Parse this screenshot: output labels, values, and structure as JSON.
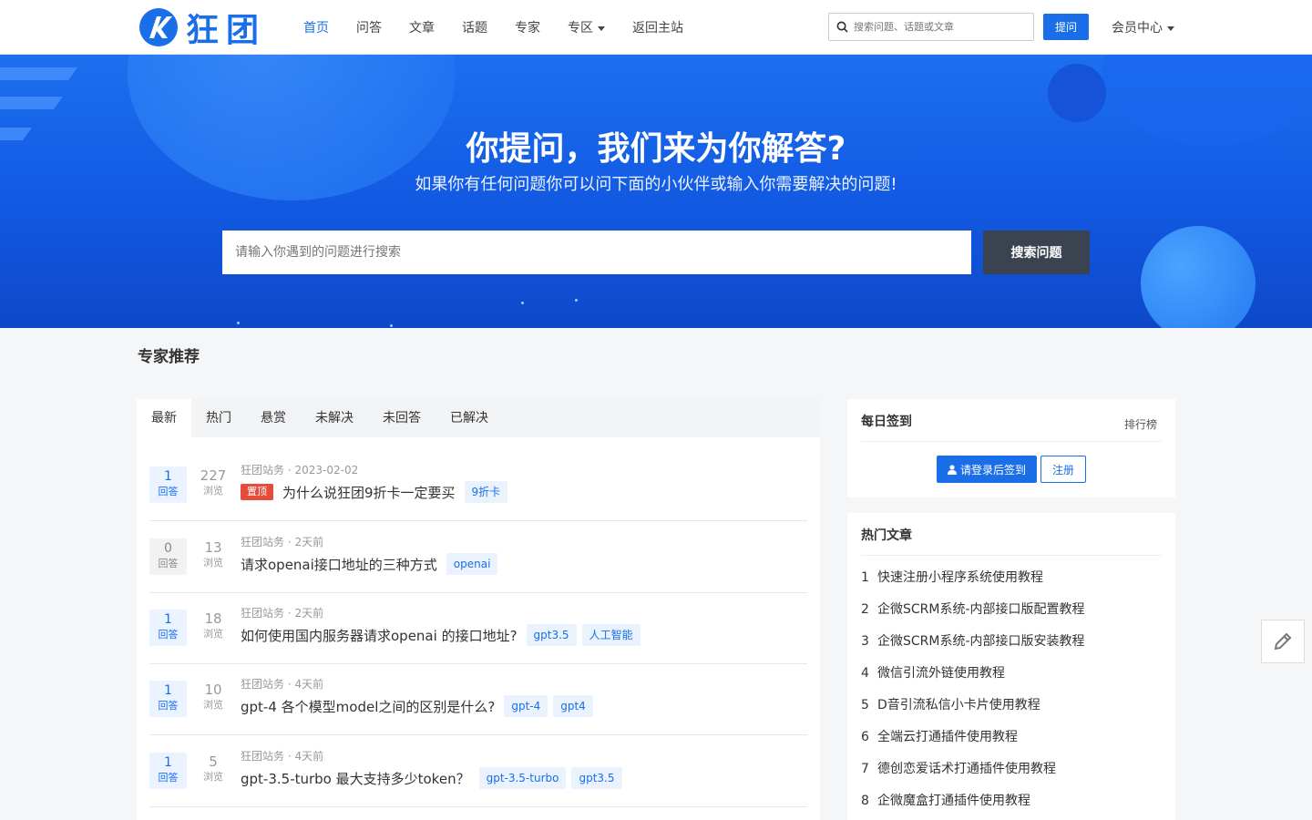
{
  "brand": {
    "name": "狂团",
    "accent": "#1a6fe8"
  },
  "nav": {
    "items": [
      {
        "label": "首页",
        "active": true
      },
      {
        "label": "问答"
      },
      {
        "label": "文章"
      },
      {
        "label": "话题"
      },
      {
        "label": "专家"
      },
      {
        "label": "专区",
        "dropdown": true
      },
      {
        "label": "返回主站"
      }
    ],
    "search_placeholder": "搜索问题、话题或文章",
    "ask_label": "提问",
    "member_label": "会员中心"
  },
  "banner": {
    "title": "你提问，我们来为你解答?",
    "subtitle": "如果你有任何问题你可以问下面的小伙伴或输入你需要解决的问题!",
    "search_placeholder": "请输入你遇到的问题进行搜索",
    "search_button": "搜索问题"
  },
  "experts": {
    "title": "专家推荐"
  },
  "tabs": [
    "最新",
    "热门",
    "悬赏",
    "未解决",
    "未回答",
    "已解决"
  ],
  "questions": [
    {
      "answers": "1",
      "answers_label": "回答",
      "views": "227",
      "views_label": "浏览",
      "author": "狂团站务",
      "time": "2023-02-02",
      "pinned": "置顶",
      "title": "为什么说狂团9折卡一定要买",
      "tags": [
        "9折卡"
      ]
    },
    {
      "answers": "0",
      "answers_label": "回答",
      "views": "13",
      "views_label": "浏览",
      "author": "狂团站务",
      "time": "2天前",
      "title": "请求openai接口地址的三种方式",
      "tags": [
        "openai"
      ]
    },
    {
      "answers": "1",
      "answers_label": "回答",
      "views": "18",
      "views_label": "浏览",
      "author": "狂团站务",
      "time": "2天前",
      "title": "如何使用国内服务器请求openai 的接口地址?",
      "tags": [
        "gpt3.5",
        "人工智能"
      ]
    },
    {
      "answers": "1",
      "answers_label": "回答",
      "views": "10",
      "views_label": "浏览",
      "author": "狂团站务",
      "time": "4天前",
      "title": "gpt-4 各个模型model之间的区别是什么?",
      "tags": [
        "gpt-4",
        "gpt4"
      ]
    },
    {
      "answers": "1",
      "answers_label": "回答",
      "views": "5",
      "views_label": "浏览",
      "author": "狂团站务",
      "time": "4天前",
      "title": "gpt-3.5-turbo 最大支持多少token？",
      "tags": [
        "gpt-3.5-turbo",
        "gpt3.5"
      ]
    }
  ],
  "checkin": {
    "title": "每日签到",
    "rank_label": "排行榜",
    "signin_label": "请登录后签到",
    "register_label": "注册"
  },
  "hot_articles": {
    "title": "热门文章",
    "items": [
      {
        "num": "1",
        "title": "快速注册小程序系统使用教程"
      },
      {
        "num": "2",
        "title": "企微SCRM系统-内部接口版配置教程"
      },
      {
        "num": "3",
        "title": "企微SCRM系统-内部接口版安装教程"
      },
      {
        "num": "4",
        "title": "微信引流外链使用教程"
      },
      {
        "num": "5",
        "title": "D音引流私信小卡片使用教程"
      },
      {
        "num": "6",
        "title": "全端云打通插件使用教程"
      },
      {
        "num": "7",
        "title": "德创恋爱话术打通插件使用教程"
      },
      {
        "num": "8",
        "title": "企微魔盒打通插件使用教程"
      }
    ]
  },
  "icons": {
    "search": "search-icon",
    "user": "user-icon",
    "edit": "pencil-icon"
  }
}
